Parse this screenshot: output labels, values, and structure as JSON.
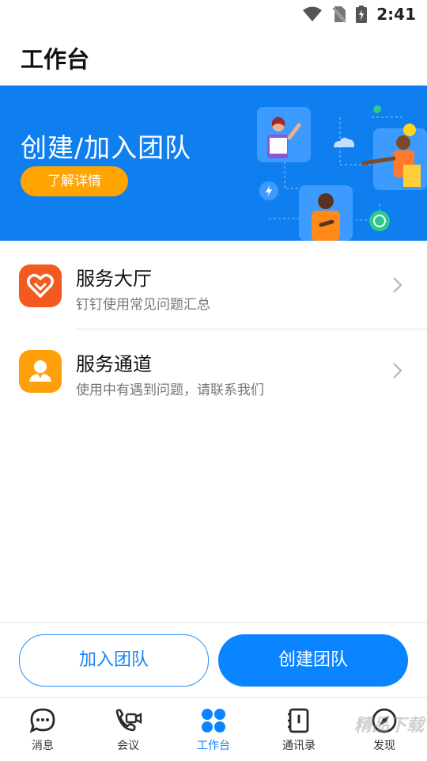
{
  "status_bar": {
    "time": "2:41"
  },
  "header": {
    "title": "工作台"
  },
  "banner": {
    "title": "创建/加入团队",
    "button_label": "了解详情"
  },
  "services": [
    {
      "title": "服务大厅",
      "subtitle": "钉钉使用常见问题汇总",
      "icon": "heart-icon",
      "color": "#f25a1f"
    },
    {
      "title": "服务通道",
      "subtitle": "使用中有遇到问题，请联系我们",
      "icon": "person-icon",
      "color": "#ff9f0a"
    }
  ],
  "actions": {
    "join_label": "加入团队",
    "create_label": "创建团队"
  },
  "tabs": [
    {
      "label": "消息",
      "icon": "chat-icon"
    },
    {
      "label": "会议",
      "icon": "video-call-icon"
    },
    {
      "label": "工作台",
      "icon": "workbench-icon",
      "active": true
    },
    {
      "label": "通讯录",
      "icon": "contacts-icon"
    },
    {
      "label": "发现",
      "icon": "compass-icon"
    }
  ],
  "watermark": "精品下载",
  "colors": {
    "primary": "#0a84ff",
    "banner": "#0f7ff0",
    "accent": "#ffa400"
  }
}
